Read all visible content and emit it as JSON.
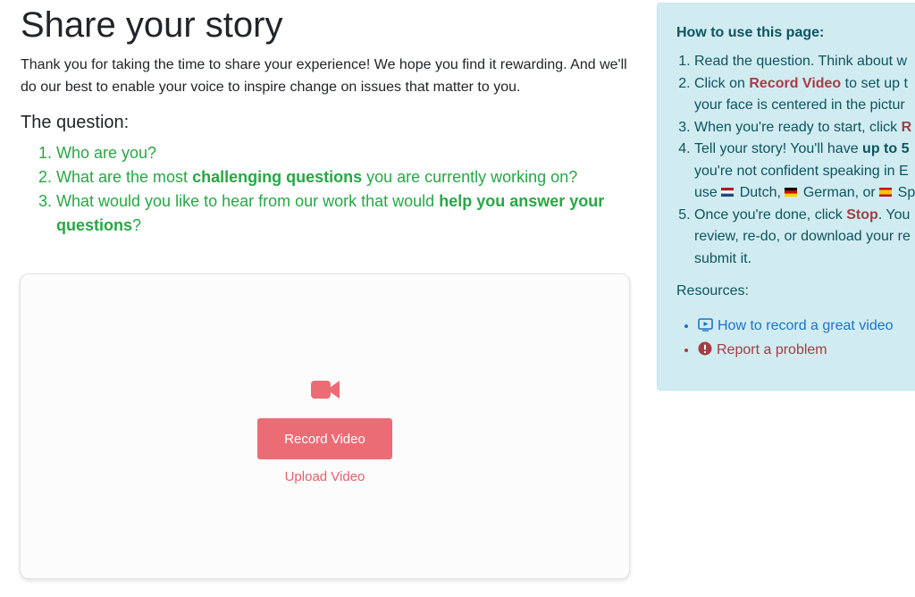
{
  "page": {
    "title": "Share your story",
    "intro": "Thank you for taking the time to share your experience! We hope you find it rewarding. And we'll do our best to enable your voice to inspire change on issues that matter to you."
  },
  "question": {
    "heading": "The question:",
    "items": [
      {
        "text": "Who are you?"
      },
      {
        "pre": "What are the most ",
        "bold": "challenging questions",
        "post": " you are currently working on?"
      },
      {
        "pre": "What would you like to hear from our work that would ",
        "bold": "help you answer your questions",
        "post": "?"
      }
    ]
  },
  "recorder": {
    "icon": "video-camera-icon",
    "record_label": "Record Video",
    "upload_label": "Upload Video",
    "accent": "#ec6c76"
  },
  "help": {
    "title": "How to use this page:",
    "steps": {
      "s1": "Read the question. Think about w",
      "s2_pre": "Click on ",
      "s2_red": "Record Video",
      "s2_post": " to set up t",
      "s2_line2": "your face is centered in the pictur",
      "s3_pre": "When you're ready to start, click ",
      "s3_red": "R",
      "s4_pre": "Tell your story! You'll have ",
      "s4_bold": "up to 5",
      "s4_line2": "you're not confident speaking in E",
      "s4_use": "use ",
      "s4_dutch": " Dutch, ",
      "s4_german": " German, or ",
      "s4_spanish": " Sp",
      "s5_pre": "Once you're done, click ",
      "s5_red": "Stop",
      "s5_post": ". You",
      "s5_line2": "review, re-do, or download your re",
      "s5_line3": "submit it."
    },
    "resources_label": "Resources:",
    "resources": [
      {
        "icon": "play-video-icon",
        "label": "How to record a great video"
      },
      {
        "icon": "exclamation-circle-icon",
        "label": "Report a problem"
      }
    ],
    "colors": {
      "background": "#d1ecf1",
      "text": "#0c5460",
      "highlight": "#a33d44",
      "link": "#1a73c8"
    }
  }
}
